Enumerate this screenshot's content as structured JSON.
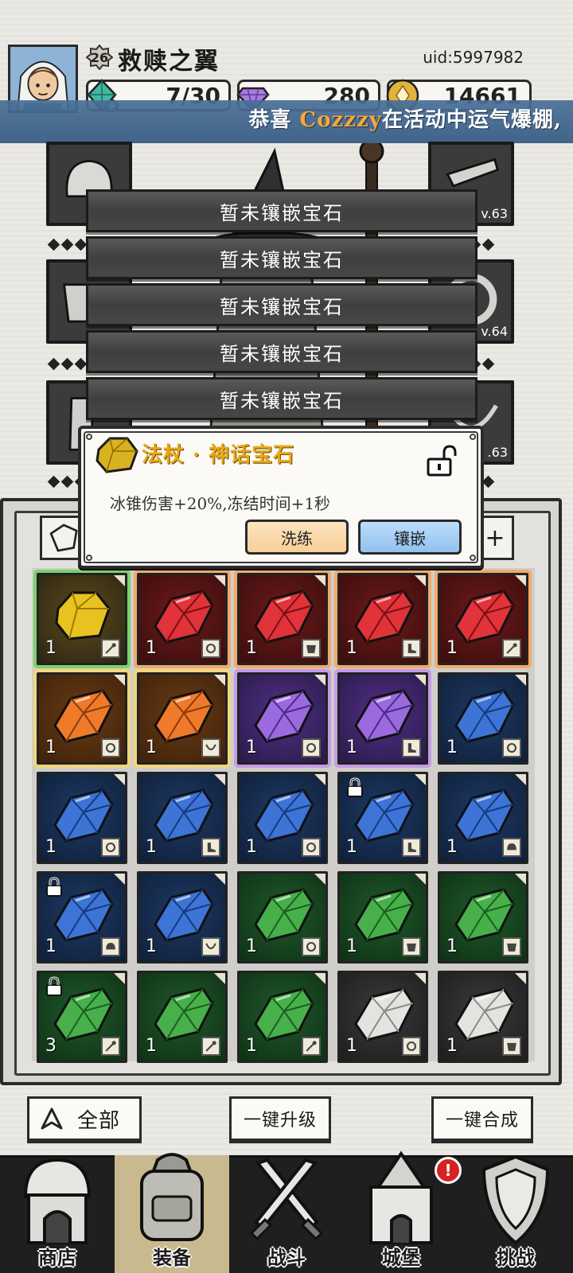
{
  "player": {
    "level": "26",
    "name": "救赎之翼",
    "uid": "uid:5997982"
  },
  "resources": {
    "energy": "7/30",
    "gems": "280",
    "gold": "14661"
  },
  "banner": {
    "prefix": "恭喜",
    "highlight": "Cozzzy",
    "suffix": "在活动中运气爆棚,"
  },
  "equipment": {
    "right_levels": [
      "v.63",
      "v.64",
      ".63"
    ]
  },
  "sockets": [
    "暂未镶嵌宝石",
    "暂未镶嵌宝石",
    "暂未镶嵌宝石",
    "暂未镶嵌宝石",
    "暂未镶嵌宝石"
  ],
  "popup": {
    "title": "法杖 · 神话宝石",
    "description": "冰锥伤害+20%,冻结时间+1秒",
    "reforge_label": "洗练",
    "inlay_label": "镶嵌"
  },
  "gems": [
    {
      "color": "gold",
      "count": "1",
      "slot": "staff",
      "locked": false
    },
    {
      "color": "red",
      "count": "1",
      "slot": "ring",
      "locked": false
    },
    {
      "color": "red",
      "count": "1",
      "slot": "armor",
      "locked": false
    },
    {
      "color": "red",
      "count": "1",
      "slot": "boots",
      "locked": false
    },
    {
      "color": "red",
      "count": "1",
      "slot": "staff",
      "locked": false
    },
    {
      "color": "orange",
      "count": "1",
      "slot": "ring",
      "locked": false
    },
    {
      "color": "orange",
      "count": "1",
      "slot": "amulet",
      "locked": false
    },
    {
      "color": "purple",
      "count": "1",
      "slot": "ring",
      "locked": false
    },
    {
      "color": "purple",
      "count": "1",
      "slot": "boots",
      "locked": false
    },
    {
      "color": "blue",
      "count": "1",
      "slot": "ring",
      "locked": false
    },
    {
      "color": "blue",
      "count": "1",
      "slot": "ring",
      "locked": false
    },
    {
      "color": "blue",
      "count": "1",
      "slot": "boots",
      "locked": false
    },
    {
      "color": "blue",
      "count": "1",
      "slot": "ring",
      "locked": false
    },
    {
      "color": "blue",
      "count": "1",
      "slot": "boots",
      "locked": true
    },
    {
      "color": "blue",
      "count": "1",
      "slot": "helmet",
      "locked": false
    },
    {
      "color": "blue",
      "count": "1",
      "slot": "helmet",
      "locked": true
    },
    {
      "color": "blue",
      "count": "1",
      "slot": "amulet",
      "locked": false
    },
    {
      "color": "green",
      "count": "1",
      "slot": "ring",
      "locked": false
    },
    {
      "color": "green",
      "count": "1",
      "slot": "armor",
      "locked": false
    },
    {
      "color": "green",
      "count": "1",
      "slot": "armor",
      "locked": false
    },
    {
      "color": "green",
      "count": "3",
      "slot": "staff",
      "locked": true
    },
    {
      "color": "green",
      "count": "1",
      "slot": "staff",
      "locked": false
    },
    {
      "color": "green",
      "count": "1",
      "slot": "staff",
      "locked": false
    },
    {
      "color": "gray",
      "count": "1",
      "slot": "ring",
      "locked": false
    },
    {
      "color": "gray",
      "count": "1",
      "slot": "armor",
      "locked": false
    }
  ],
  "actions": {
    "filter_all": "全部",
    "upgrade_all": "一键升级",
    "merge_all": "一键合成"
  },
  "nav": [
    {
      "label": "商店",
      "icon": "shop-icon"
    },
    {
      "label": "装备",
      "icon": "backpack-icon"
    },
    {
      "label": "战斗",
      "icon": "crossed-swords-icon"
    },
    {
      "label": "城堡",
      "icon": "castle-icon"
    },
    {
      "label": "挑战",
      "icon": "shield-icon"
    }
  ],
  "notification_badge": "!",
  "colors": {
    "banner": "#3d6490",
    "highlight": "#f7a83a",
    "popup_title": "#e8a818",
    "reforge_button": "#f7cf97",
    "inlay_button": "#92c1ee",
    "active_tab": "#c9b98f"
  }
}
